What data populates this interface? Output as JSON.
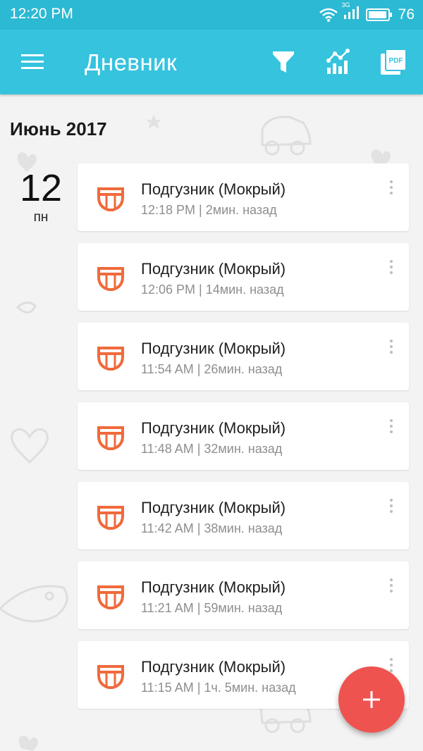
{
  "status": {
    "time": "12:20 PM",
    "network": "3G",
    "battery": "76"
  },
  "appbar": {
    "title": "Дневник",
    "menu_icon": "menu-icon",
    "actions": [
      "filter-icon",
      "chart-icon",
      "pdf-icon"
    ],
    "pdf_label": "PDF"
  },
  "colors": {
    "header": "#35c3de",
    "status_bar": "#2cb9d3",
    "accent_icon": "#f06a3b",
    "fab": "#ef5350",
    "background": "#f3f3f3"
  },
  "month": "Июнь 2017",
  "day": {
    "number": "12",
    "name": "пн"
  },
  "entries": [
    {
      "title": "Подгузник (Мокрый)",
      "subtitle": "12:18 PM  |  2мин. назад"
    },
    {
      "title": "Подгузник (Мокрый)",
      "subtitle": "12:06 PM  |  14мин. назад"
    },
    {
      "title": "Подгузник (Мокрый)",
      "subtitle": "11:54 AM  |  26мин. назад"
    },
    {
      "title": "Подгузник (Мокрый)",
      "subtitle": "11:48 AM  |  32мин. назад"
    },
    {
      "title": "Подгузник (Мокрый)",
      "subtitle": "11:42 AM  |  38мин. назад"
    },
    {
      "title": "Подгузник (Мокрый)",
      "subtitle": "11:21 AM  |  59мин. назад"
    },
    {
      "title": "Подгузник (Мокрый)",
      "subtitle": "11:15 AM  |  1ч. 5мин. назад"
    }
  ],
  "fab": {
    "icon": "plus-icon"
  }
}
